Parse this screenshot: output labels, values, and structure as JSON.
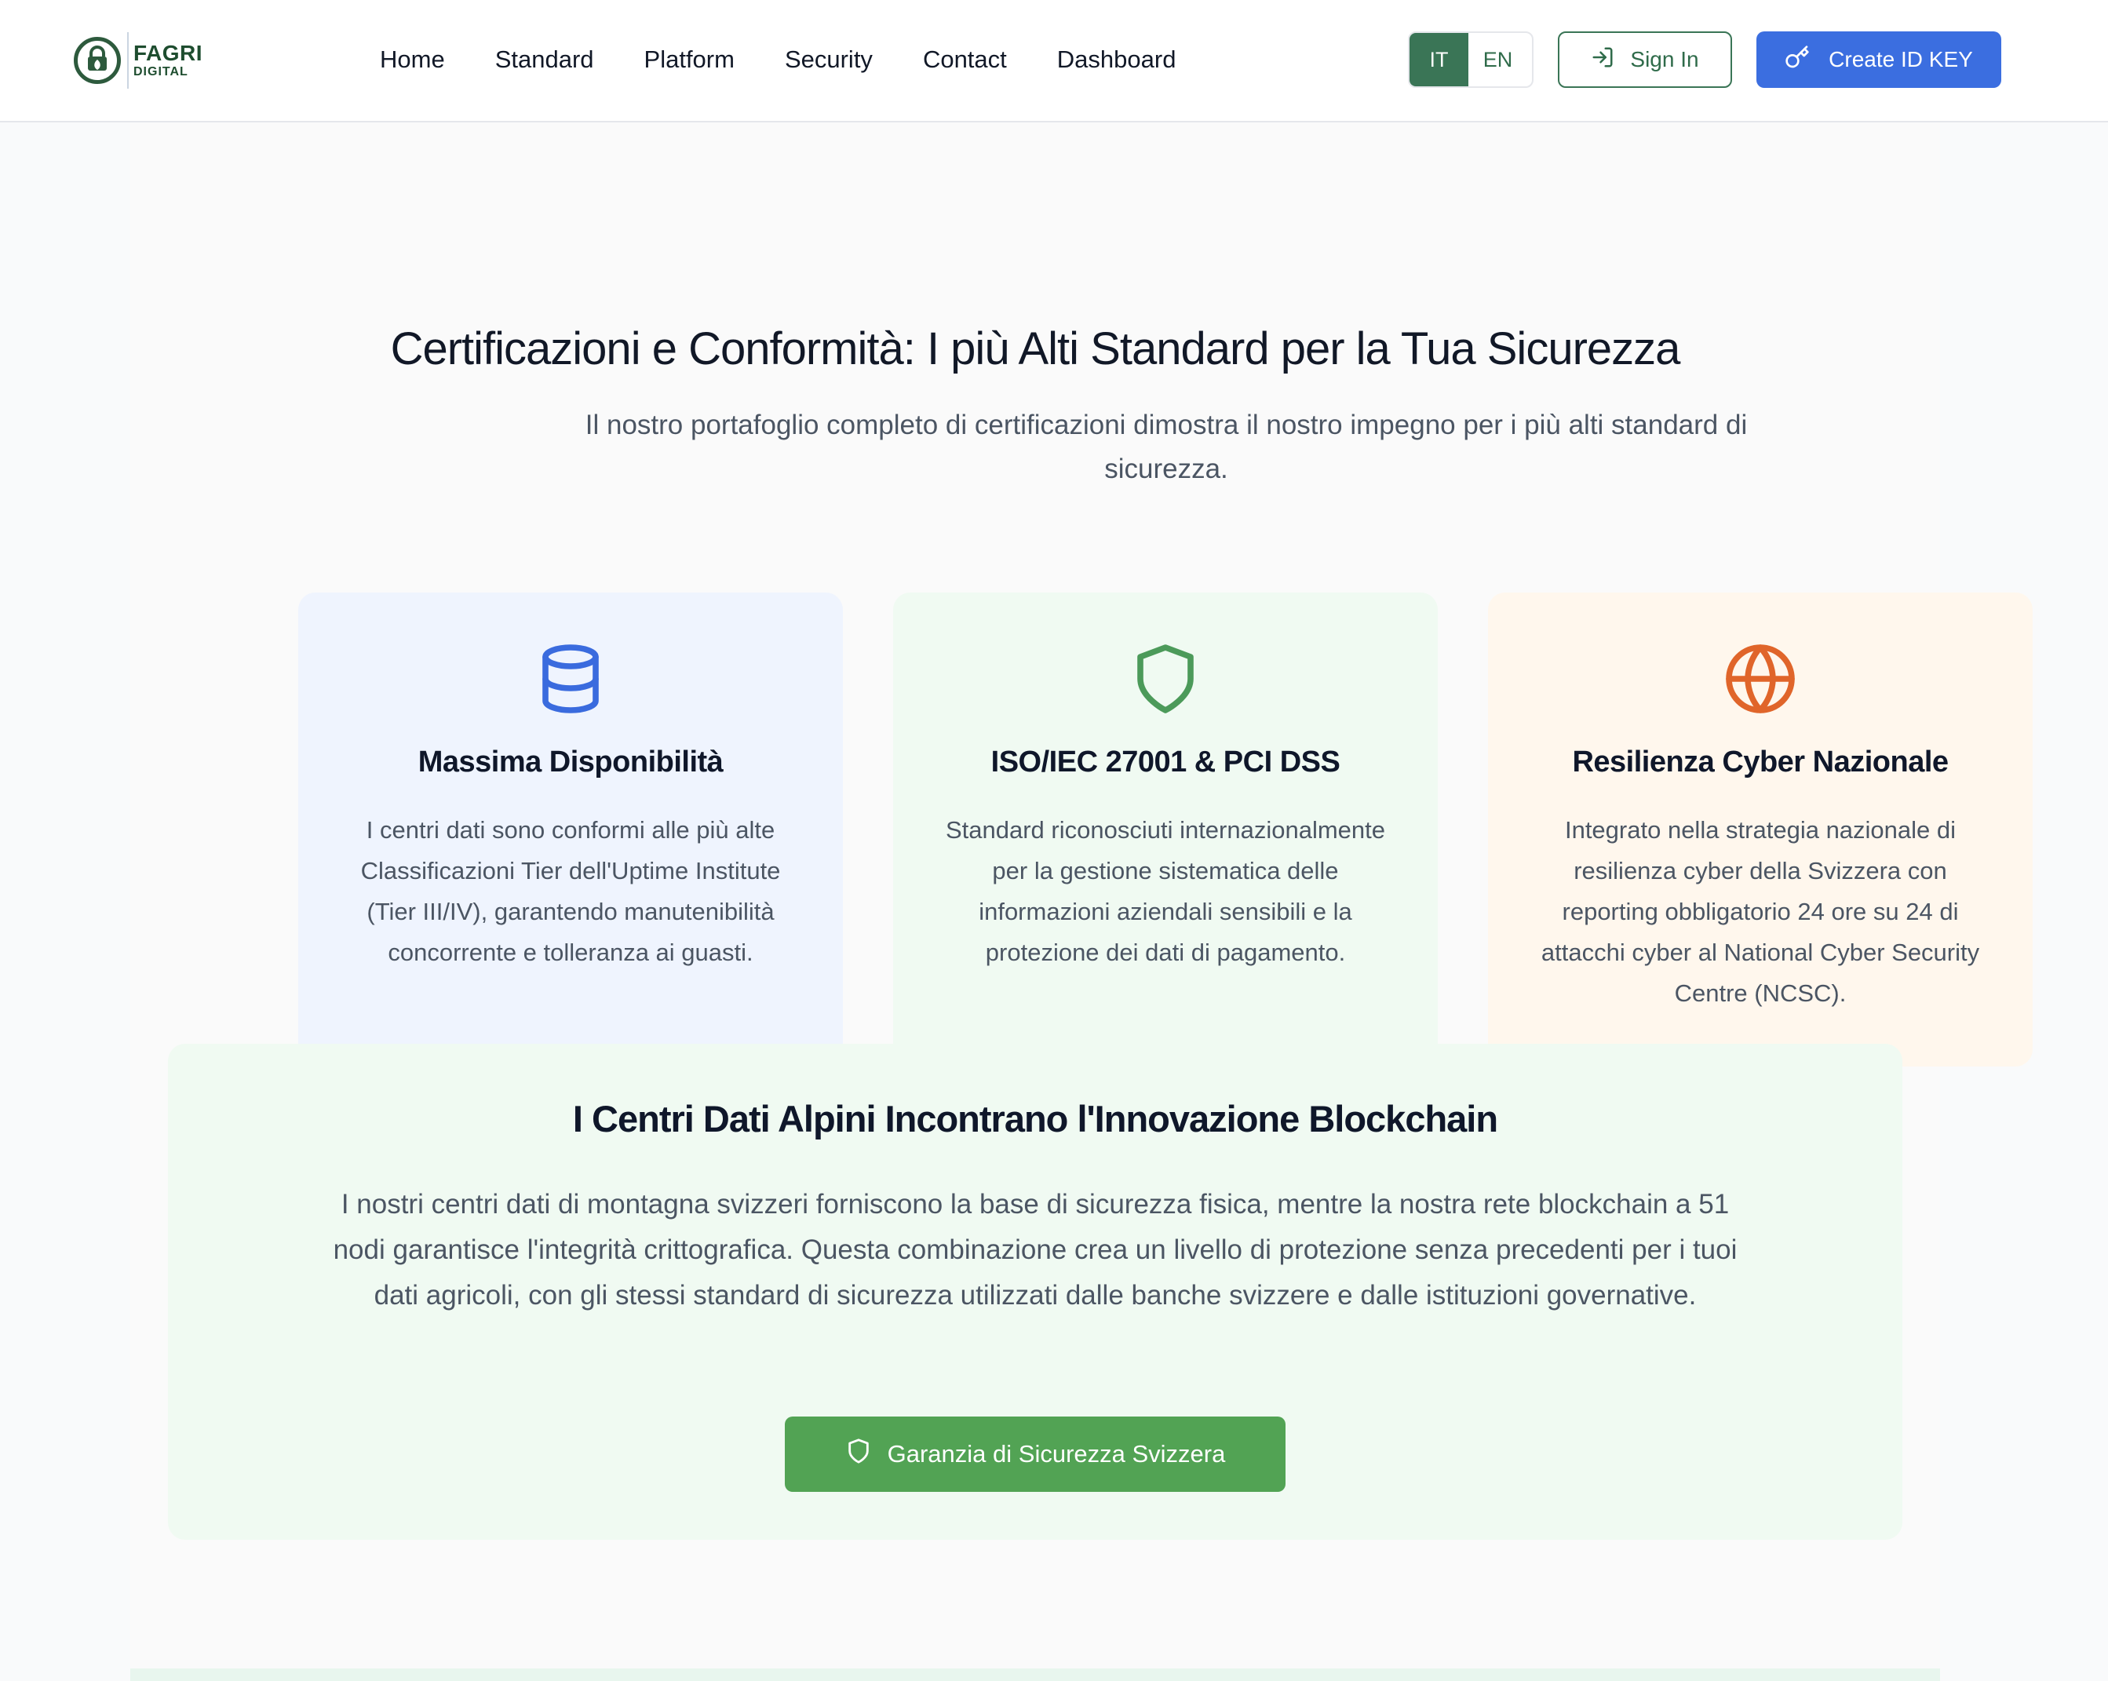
{
  "brand": {
    "line1": "FAGRI",
    "line2": "DIGITAL"
  },
  "nav": {
    "links": [
      "Home",
      "Standard",
      "Platform",
      "Security",
      "Contact",
      "Dashboard"
    ],
    "lang_it": "IT",
    "lang_en": "EN",
    "signin_label": "Sign In",
    "create_label": "Create ID KEY"
  },
  "hero": {
    "title": "Certificazioni e Conformità: I più Alti Standard per la Tua Sicurezza",
    "subtitle": "Il nostro portafoglio completo di certificazioni dimostra il nostro impegno per i più alti standard di sicurezza."
  },
  "cards": [
    {
      "icon": "database-icon",
      "title": "Massima Disponibilità",
      "body": "I centri dati sono conformi alle più alte Classificazioni Tier dell'Uptime Institute (Tier III/IV), garantendo manutenibilità concorrente e tolleranza ai guasti."
    },
    {
      "icon": "shield-icon",
      "title": "ISO/IEC 27001 & PCI DSS",
      "body": "Standard riconosciuti internazionalmente per la gestione sistematica delle informazioni aziendali sensibili e la protezione dei dati di pagamento."
    },
    {
      "icon": "globe-icon",
      "title": "Resilienza Cyber Nazionale",
      "body": "Integrato nella strategia nazionale di resilienza cyber della Svizzera con reporting obbligatorio 24 ore su 24 di attacchi cyber al National Cyber Security Centre (NCSC)."
    }
  ],
  "blockchain": {
    "title": "I Centri Dati Alpini Incontrano l'Innovazione Blockchain",
    "body": "I nostri centri dati di montagna svizzeri forniscono la base di sicurezza fisica, mentre la nostra rete blockchain a 51 nodi garantisce l'integrità crittografica. Questa combinazione crea un livello di protezione senza precedenti per i tuoi dati agricoli, con gli stessi standard di sicurezza utilizzati dalle banche svizzere e dalle istituzioni governative.",
    "button_label": "Garanzia di Sicurezza Svizzera"
  },
  "colors": {
    "primary_green": "#3a7556",
    "button_green": "#52a354",
    "primary_blue": "#3b6ee0",
    "icon_blue": "#3a6bde",
    "icon_green": "#4c9a5a",
    "icon_orange": "#e0652a"
  }
}
